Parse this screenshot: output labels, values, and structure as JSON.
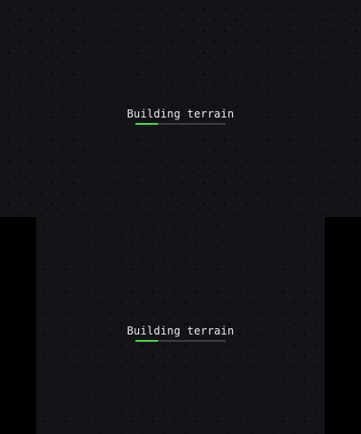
{
  "top_screen": {
    "status_label": "Building terrain",
    "progress": 0.25
  },
  "bottom_screen": {
    "status_label": "Building terrain",
    "progress": 0.25
  },
  "colors": {
    "background": "#131417",
    "letterbox": "#000000",
    "text": "#e9ecef",
    "progress_track": "#3a3d42",
    "progress_fill": "#4cd64c"
  }
}
